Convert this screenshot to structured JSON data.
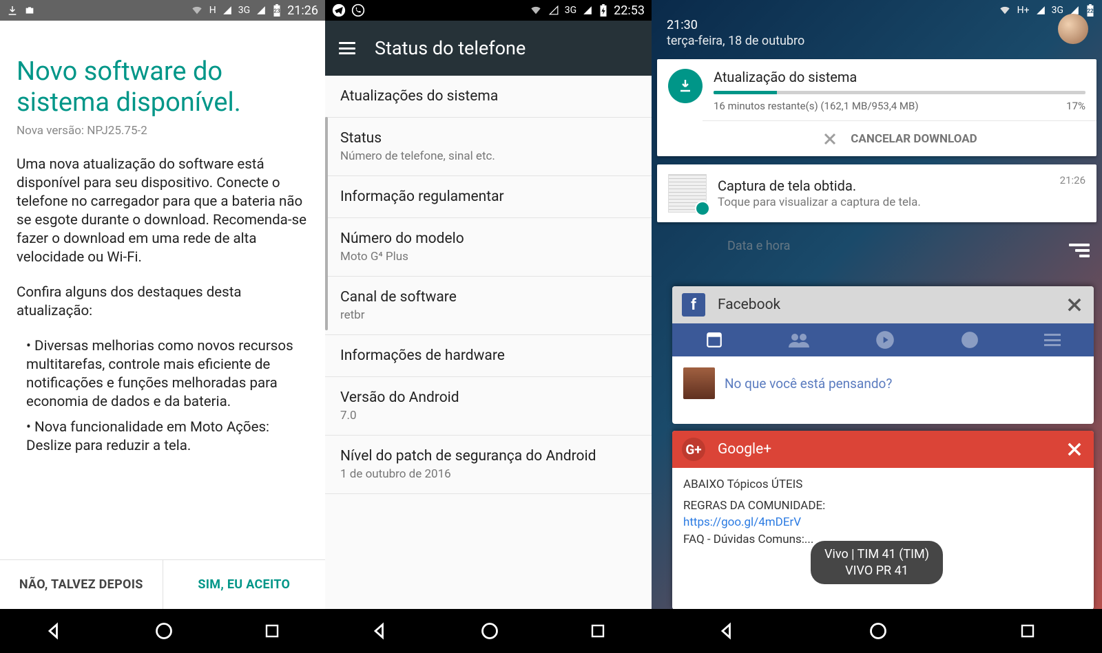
{
  "panel1": {
    "status": {
      "time": "21:26",
      "net_mode": "H",
      "signal_label": "3G",
      "battery": "23"
    },
    "title": "Novo software do sistema disponível.",
    "version_line": "Nova versão: NPJ25.75-2",
    "para1": "Uma nova atualização do software está disponível para seu dispositivo. Conecte o telefone no carregador para que a bateria não se esgote durante o download. Recomenda-se fazer o download em uma rede de alta velocidade ou Wi-Fi.",
    "para2": "Confira alguns dos destaques desta atualização:",
    "bullet1": "•  Diversas melhorias como novos recursos multitarefas, controle mais eficiente de notificações e funções melhoradas para economia de dados e da bateria.",
    "bullet2": "•  Nova funcionalidade em Moto Ações: Deslize para reduzir a tela.",
    "decline": "NÃO, TALVEZ DEPOIS",
    "accept": "SIM, EU ACEITO"
  },
  "panel2": {
    "status": {
      "time": "22:53",
      "signal_label": "3G"
    },
    "toolbar_title": "Status do telefone",
    "items": [
      {
        "title": "Atualizações do sistema",
        "sub": ""
      },
      {
        "title": "Status",
        "sub": "Número de telefone, sinal etc."
      },
      {
        "title": "Informação regulamentar",
        "sub": ""
      },
      {
        "title": "Número do modelo",
        "sub": "Moto G⁴ Plus"
      },
      {
        "title": "Canal de software",
        "sub": "retbr"
      },
      {
        "title": "Informações de hardware",
        "sub": ""
      },
      {
        "title": "Versão do Android",
        "sub": "7.0"
      },
      {
        "title": "Nível do patch de segurança do Android",
        "sub": "1 de outubro de 2016"
      }
    ]
  },
  "panel3": {
    "status": {
      "time_small": "21:30",
      "date": "terça-feira, 18 de outubro",
      "net_mode": "H+",
      "signal_label": "3G",
      "battery": "22"
    },
    "notif_update": {
      "title": "Atualização do sistema",
      "progress_text": "16 minutos restante(s) (162,1 MB/953,4 MB)",
      "percent": "17%",
      "cancel": "CANCELAR DOWNLOAD",
      "progress_pct": 17
    },
    "notif_screenshot": {
      "title": "Captura de tela obtida.",
      "sub": "Toque para visualizar a captura de tela.",
      "time": "21:26"
    },
    "bg_setting": "Data e hora",
    "recents": {
      "facebook": {
        "name": "Facebook",
        "prompt": "No que você está pensando?"
      },
      "googleplus": {
        "name": "Google+",
        "line1": "ABAIXO Tópicos ÚTEIS",
        "line2": "REGRAS DA COMUNIDADE:",
        "link": "https://goo.gl/4mDErV",
        "line3": "FAQ - Dúvidas Comuns:..."
      }
    },
    "carrier_tooltip_l1": "Vivo | TIM 41 (TIM)",
    "carrier_tooltip_l2": "VIVO PR 41"
  }
}
